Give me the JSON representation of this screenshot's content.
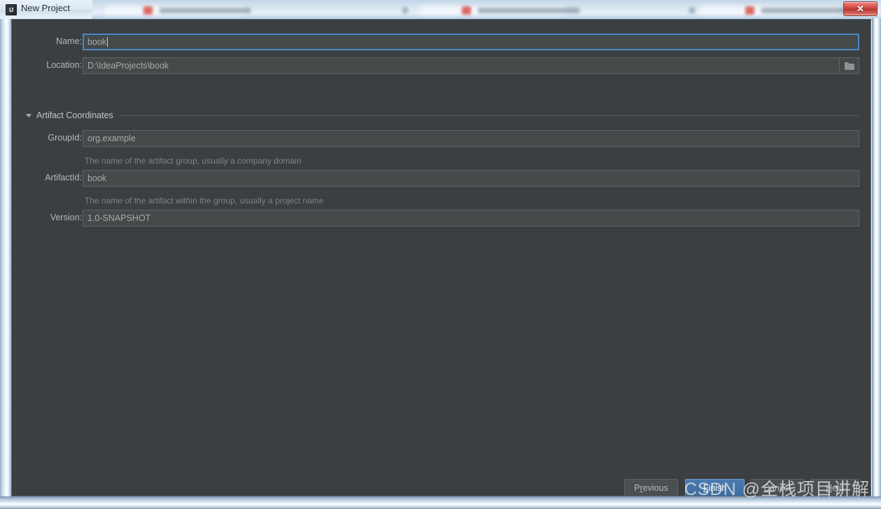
{
  "window": {
    "title": "New Project",
    "app_icon": "intellij-idea-icon",
    "close_label": "✕"
  },
  "form": {
    "name": {
      "label": "Name:",
      "value": "book",
      "focused": true
    },
    "location": {
      "label": "Location:",
      "value": "D:\\IdeaProjects\\book",
      "browse_icon": "folder-icon"
    }
  },
  "artifact_section": {
    "title": "Artifact Coordinates",
    "expanded": true,
    "expand_icon": "triangle-down-icon",
    "fields": [
      {
        "label": "GroupId:",
        "value": "org.example",
        "hint": "The name of the artifact group, usually a company domain"
      },
      {
        "label": "ArtifactId:",
        "value": "book",
        "hint": "The name of the artifact within the group, usually a project name"
      },
      {
        "label": "Version:",
        "value": "1.0-SNAPSHOT",
        "hint": ""
      }
    ]
  },
  "buttons": {
    "previous": {
      "prefix": "P",
      "mnemonic": "r",
      "suffix": "evious"
    },
    "finish": {
      "prefix": "",
      "mnemonic": "F",
      "suffix": "inish"
    },
    "cancel": {
      "prefix": "",
      "mnemonic": "C",
      "suffix": "ancel"
    },
    "help": {
      "prefix": "",
      "mnemonic": "H",
      "suffix": "elp"
    }
  },
  "watermark": {
    "text": "CSDN @全栈项目讲解"
  },
  "colors": {
    "panel_bg": "#3c3f41",
    "field_bg": "#45494a",
    "accent_blue": "#4a88c7",
    "primary_button": "#3e6b9c",
    "close_red": "#c2413c"
  }
}
